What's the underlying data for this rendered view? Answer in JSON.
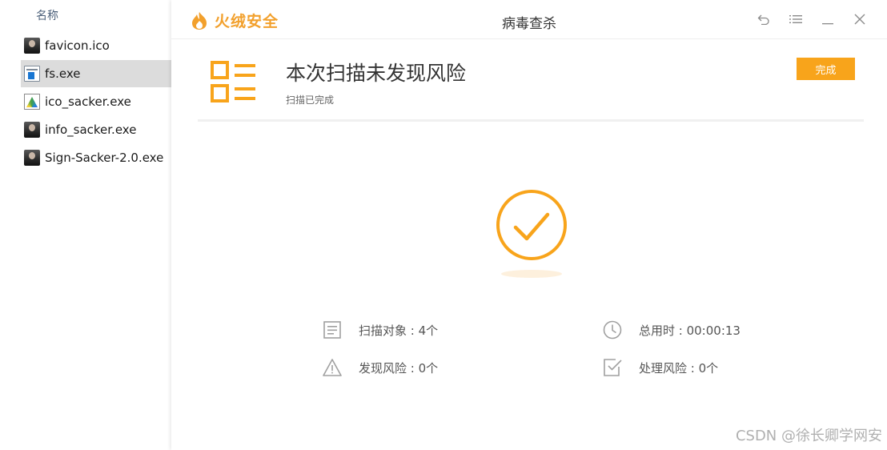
{
  "explorer": {
    "column_header": "名称",
    "files": [
      {
        "name": "favicon.ico",
        "icon": "photo-thumbnail-icon",
        "selected": false
      },
      {
        "name": "fs.exe",
        "icon": "exe-file-icon",
        "selected": true
      },
      {
        "name": "ico_sacker.exe",
        "icon": "rainbow-app-icon",
        "selected": false
      },
      {
        "name": "info_sacker.exe",
        "icon": "photo-thumbnail-icon",
        "selected": false
      },
      {
        "name": "Sign-Sacker-2.0.exe",
        "icon": "photo-thumbnail-icon",
        "selected": false
      }
    ]
  },
  "app": {
    "brand_name": "火绒安全",
    "window_title": "病毒查杀",
    "controls": [
      "back-icon",
      "menu-icon",
      "minimize-icon",
      "close-icon"
    ],
    "accent_color": "#f8a41b"
  },
  "result": {
    "title": "本次扫描未发现风险",
    "subtitle": "扫描已完成",
    "done_button": "完成"
  },
  "stats": {
    "scanned": "扫描对象 : 4个",
    "duration": "总用时 : 00:00:13",
    "risks_found": "发现风险 : 0个",
    "risks_handled": "处理风险 : 0个"
  },
  "watermark": "CSDN @徐长卿学网安"
}
